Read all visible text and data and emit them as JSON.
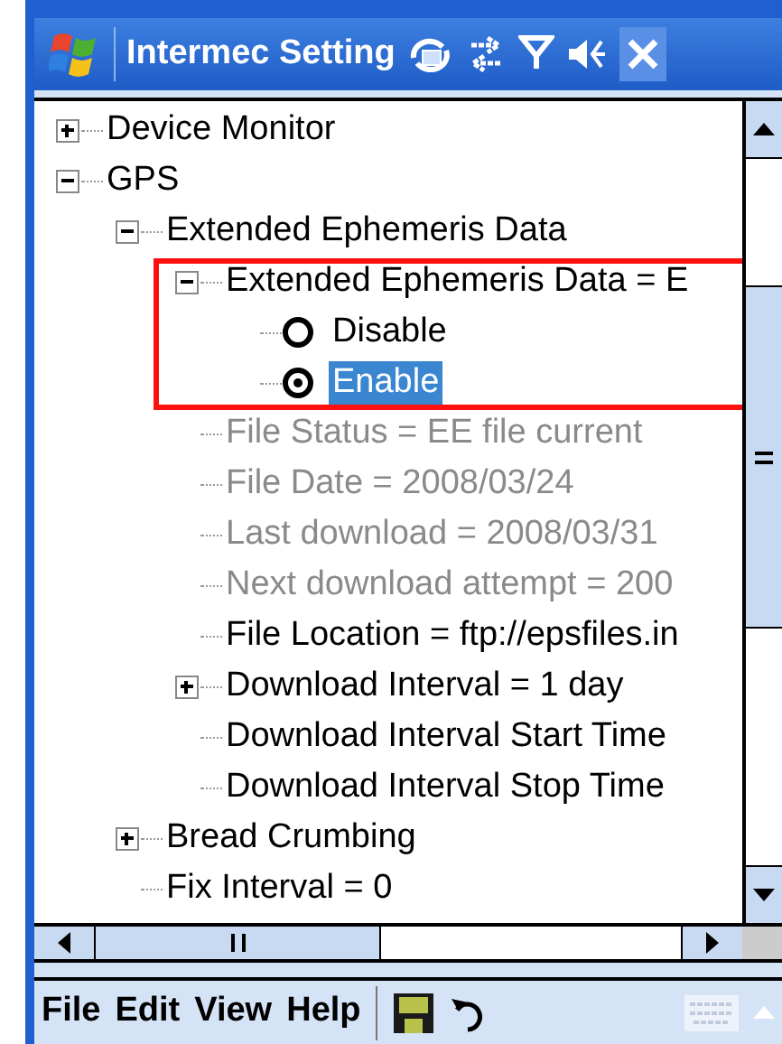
{
  "window": {
    "title": "Intermec Setting"
  },
  "tree": [
    {
      "label": "Device Monitor",
      "kind": "node",
      "expanded": false,
      "disabled": false
    },
    {
      "label": "GPS",
      "kind": "node",
      "expanded": true,
      "disabled": false,
      "children": [
        {
          "label": "Extended Ephemeris Data",
          "kind": "node",
          "expanded": true,
          "disabled": false,
          "children": [
            {
              "label": "Extended Ephemeris Data = E",
              "kind": "node",
              "expanded": true,
              "disabled": false,
              "children": [
                {
                  "label": "Disable",
                  "kind": "radio",
                  "selected": false,
                  "disabled": false
                },
                {
                  "label": "Enable",
                  "kind": "radio",
                  "selected": true,
                  "disabled": false
                }
              ]
            },
            {
              "label": "File Status = EE file current",
              "kind": "leaf",
              "disabled": true
            },
            {
              "label": "File Date = 2008/03/24",
              "kind": "leaf",
              "disabled": true
            },
            {
              "label": "Last download = 2008/03/31",
              "kind": "leaf",
              "disabled": true
            },
            {
              "label": "Next download attempt = 200",
              "kind": "leaf",
              "disabled": true
            },
            {
              "label": "File Location = ftp://epsfiles.in",
              "kind": "leaf",
              "disabled": false
            },
            {
              "label": "Download Interval = 1 day",
              "kind": "node",
              "expanded": false,
              "disabled": false
            },
            {
              "label": "Download Interval Start Time",
              "kind": "leaf",
              "disabled": false
            },
            {
              "label": "Download Interval Stop Time",
              "kind": "leaf",
              "disabled": false
            }
          ]
        },
        {
          "label": "Bread Crumbing",
          "kind": "node",
          "expanded": false,
          "disabled": false
        },
        {
          "label": "Fix Interval = 0",
          "kind": "leaf",
          "disabled": false
        }
      ]
    }
  ],
  "menu": [
    "File",
    "Edit",
    "View",
    "Help"
  ]
}
